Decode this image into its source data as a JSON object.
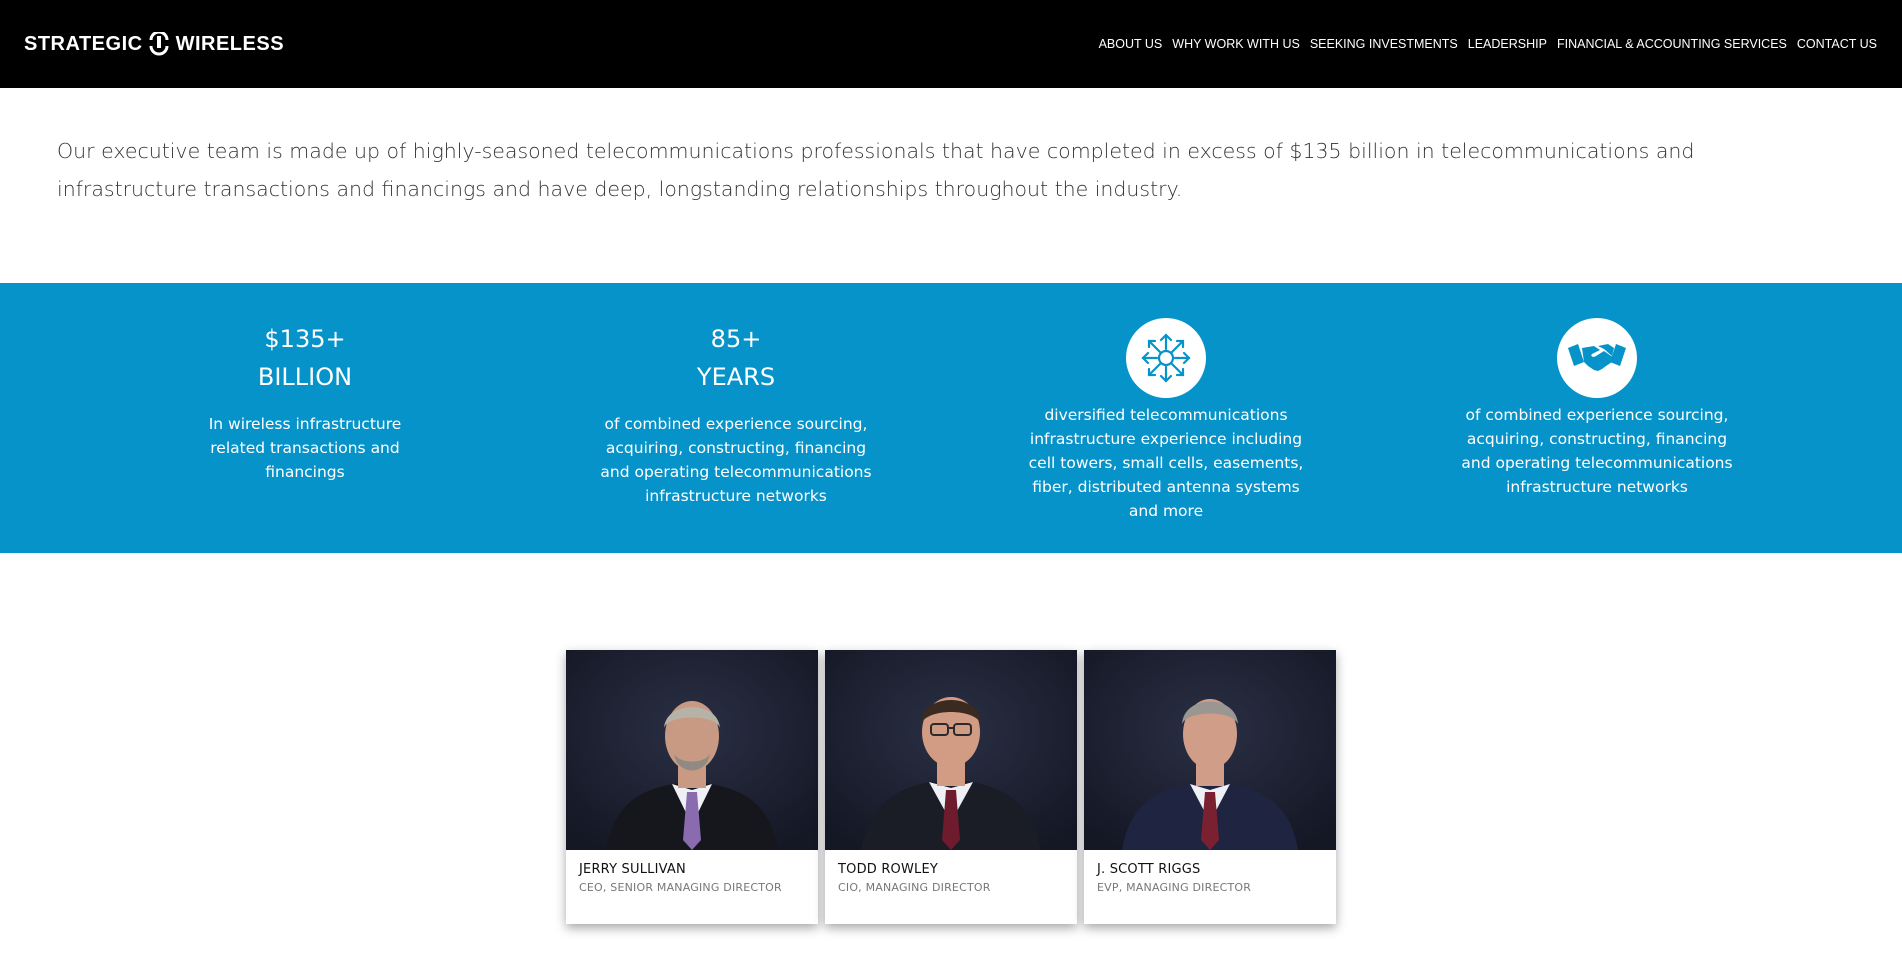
{
  "header": {
    "logo_left": "STRATEGIC",
    "logo_right": "WIRELESS",
    "nav": [
      {
        "label": "ABOUT US"
      },
      {
        "label": "WHY WORK WITH US"
      },
      {
        "label": "SEEKING INVESTMENTS"
      },
      {
        "label": "LEADERSHIP"
      },
      {
        "label": "FINANCIAL & ACCOUNTING SERVICES"
      },
      {
        "label": "CONTACT US"
      }
    ]
  },
  "intro": {
    "text": "Our executive team is made up of highly-seasoned telecommunications professionals that have completed in excess of $135 billion in telecommunications and infrastructure transactions and financings and have deep, longstanding relationships throughout the industry."
  },
  "colors": {
    "band": "#0693c9",
    "header": "#000000",
    "icon": "#0693c9"
  },
  "stats": [
    {
      "line1": "$135+",
      "line2": "BILLION",
      "desc": "In wireless infrastructure related transactions and financings"
    },
    {
      "line1": "85+",
      "line2": "YEARS",
      "desc": "of combined experience sourcing, acquiring, constructing, financing and operating telecommunications infrastructure networks"
    },
    {
      "icon": "network-arrows-icon",
      "desc": "diversified telecommunications infrastructure experience including cell towers, small cells, easements, fiber, distributed antenna systems and more"
    },
    {
      "icon": "handshake-icon",
      "desc": "of combined experience sourcing, acquiring, constructing, financing and operating telecommunications infrastructure networks"
    }
  ],
  "team": [
    {
      "name": "JERRY SULLIVAN",
      "role": "CEO, SENIOR MANAGING DIRECTOR",
      "tie": "#8a6bb0",
      "hair": "#b7b2a8",
      "skin": "#c99a83"
    },
    {
      "name": "TODD ROWLEY",
      "role": "CIO, MANAGING DIRECTOR",
      "tie": "#6e1b2e",
      "hair": "#3a2a20",
      "skin": "#d29b84"
    },
    {
      "name": "J. SCOTT RIGGS",
      "role": "EVP, MANAGING DIRECTOR",
      "tie": "#7a2030",
      "hair": "#9a9691",
      "skin": "#cf9d88"
    }
  ]
}
